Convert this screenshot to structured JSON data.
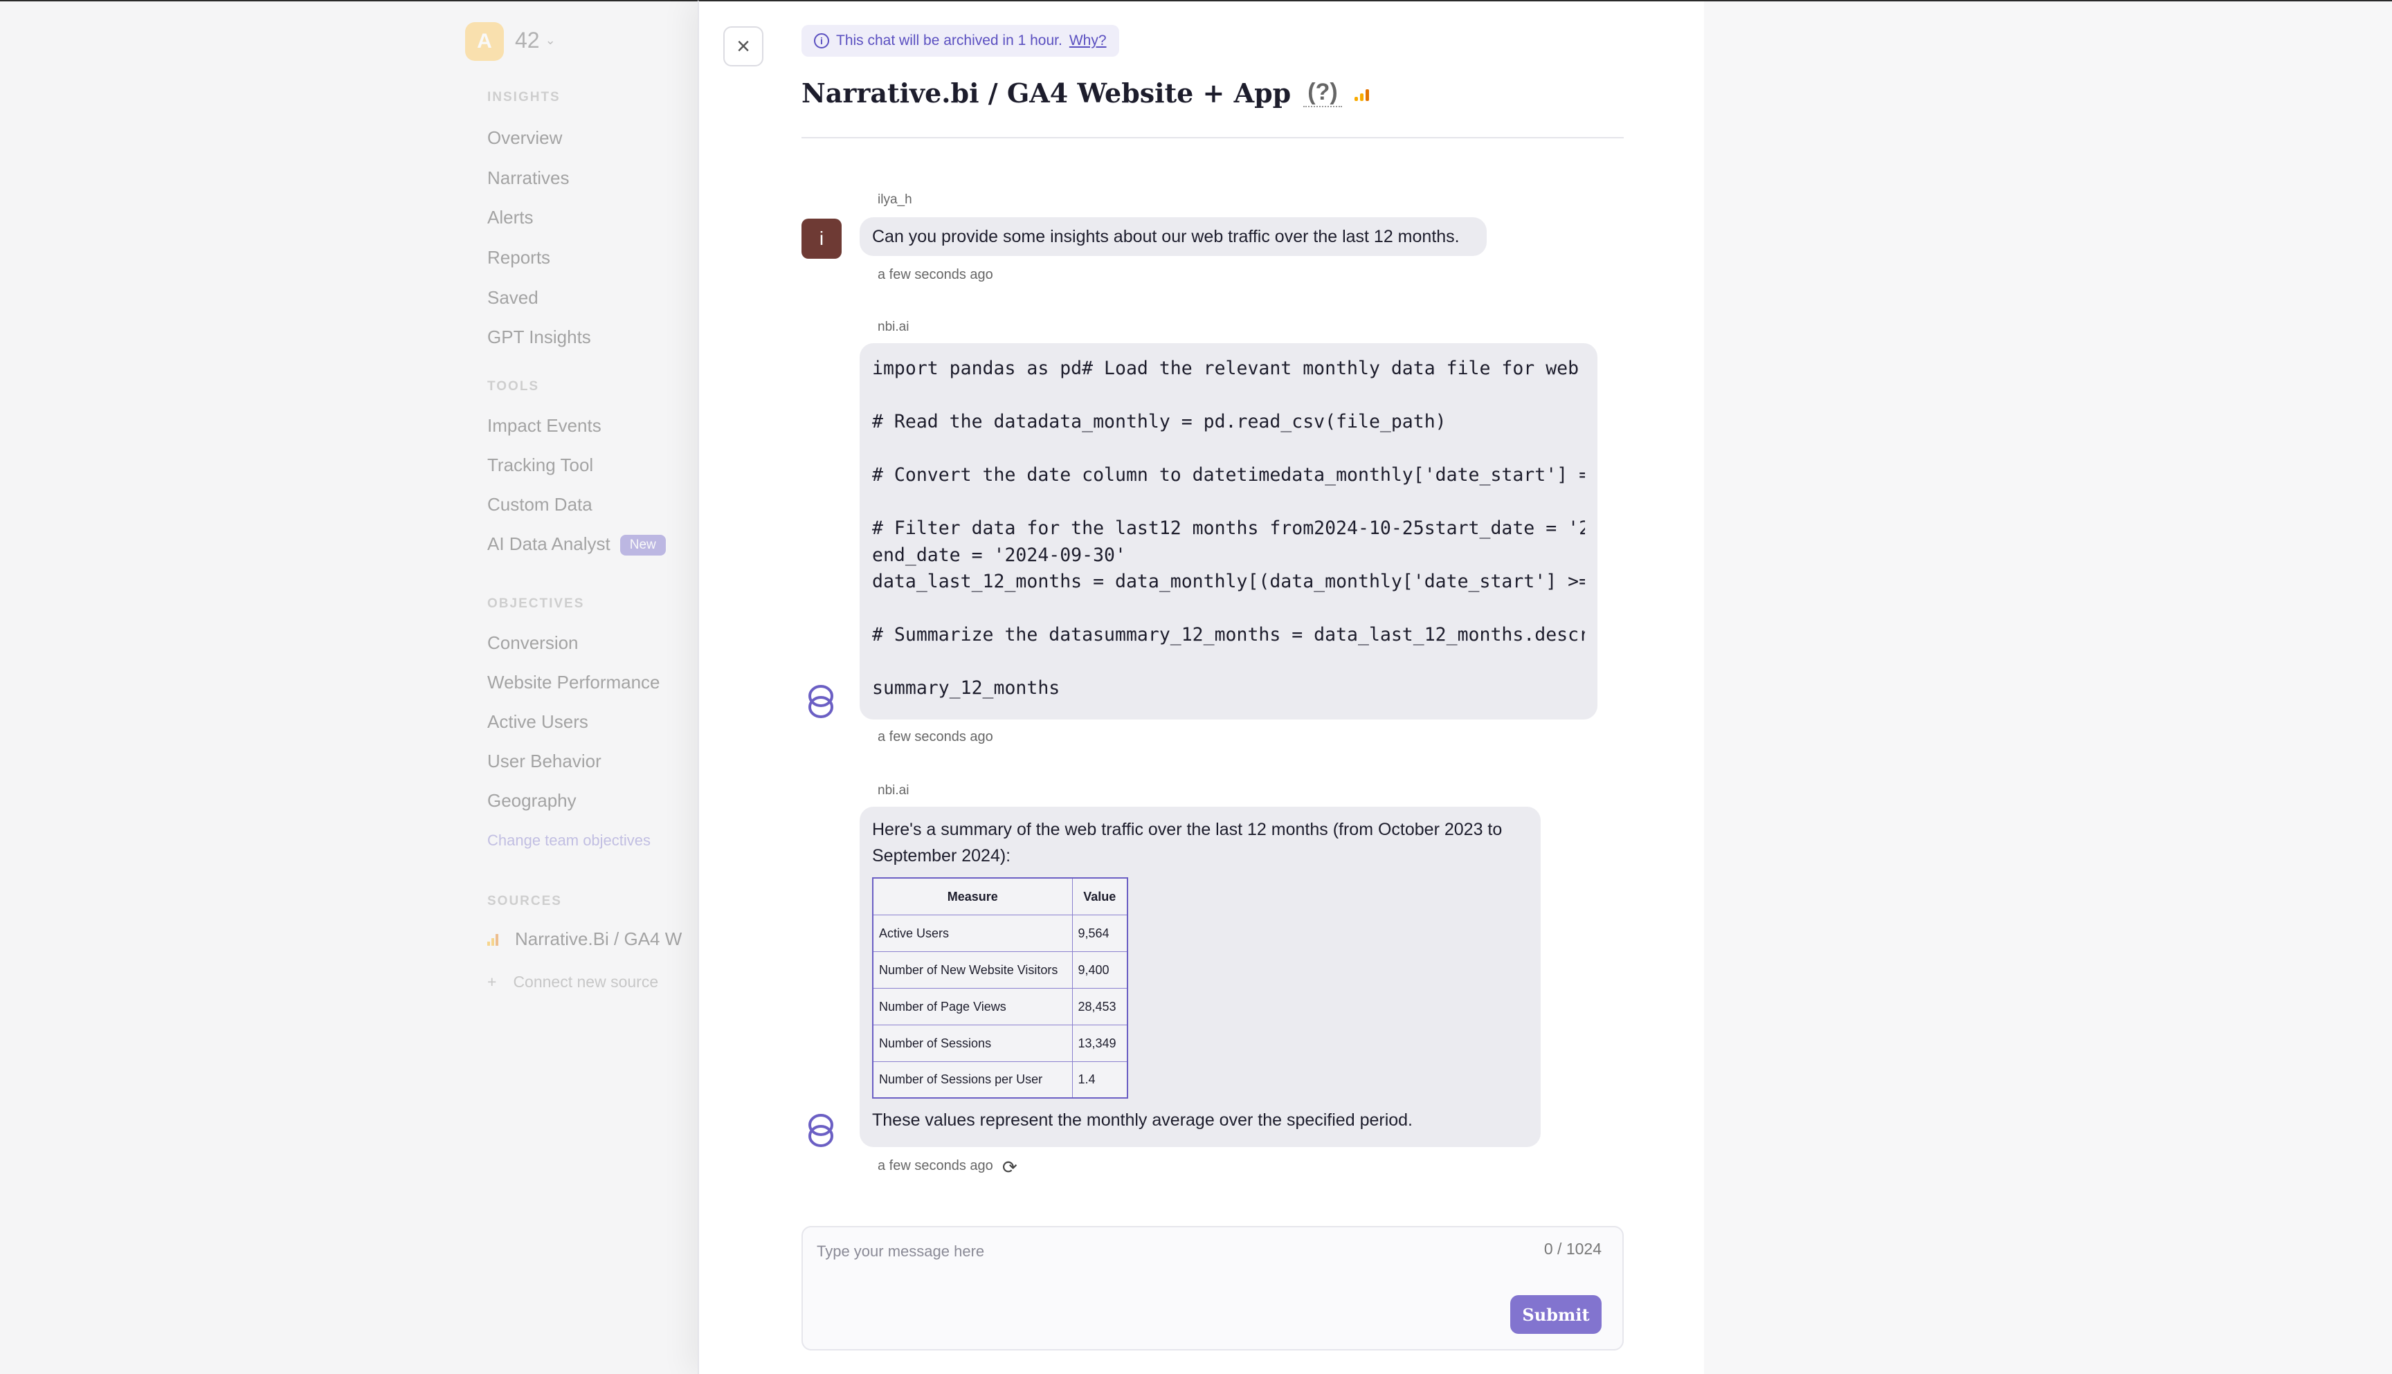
{
  "sidebar": {
    "logo_letter": "A",
    "team_count": "42",
    "sections": {
      "insights": "INSIGHTS",
      "tools": "TOOLS",
      "objectives": "OBJECTIVES",
      "sources": "SOURCES"
    },
    "insights_items": [
      "Overview",
      "Narratives",
      "Alerts",
      "Reports",
      "Saved",
      "GPT Insights"
    ],
    "tools_items": [
      "Impact Events",
      "Tracking Tool",
      "Custom Data",
      "AI Data Analyst"
    ],
    "new_badge": "New",
    "objectives_items": [
      "Conversion",
      "Website Performance",
      "Active Users",
      "User Behavior",
      "Geography"
    ],
    "change_objectives": "Change team objectives",
    "source_name": "Narrative.Bi / GA4 W",
    "connect_source": "Connect new source"
  },
  "panel": {
    "archive_notice": "This chat will be archived in 1 hour.",
    "archive_why": "Why?",
    "title": "Narrative.bi / GA4 Website + App",
    "help": "(?)"
  },
  "messages": [
    {
      "author": "ilya_h",
      "avatar_letter": "i",
      "text": "Can you provide some insights about our web traffic over the last 12 months.",
      "time": "a few seconds ago"
    },
    {
      "author": "nbi.ai",
      "code": "import pandas as pd# Load the relevant monthly data file for web tr\n\n# Read the datadata_monthly = pd.read_csv(file_path)\n\n# Convert the date column to datetimedata_monthly['date_start'] = p\n\n# Filter data for the last12 months from2024-10-25start_date = '202\nend_date = '2024-09-30'\ndata_last_12_months = data_monthly[(data_monthly['date_start'] >= s\n\n# Summarize the datasummary_12_months = data_last_12_months.describ\n\nsummary_12_months",
      "time": "a few seconds ago"
    },
    {
      "author": "nbi.ai",
      "intro": "Here's a summary of the web traffic over the last 12 months (from October 2023 to September 2024):",
      "table_headers": [
        "Measure",
        "Value"
      ],
      "table_rows": [
        [
          "Active Users",
          "9,564"
        ],
        [
          "Number of New Website Visitors",
          "9,400"
        ],
        [
          "Number of Page Views",
          "28,453"
        ],
        [
          "Number of Sessions",
          "13,349"
        ],
        [
          "Number of Sessions per User",
          "1.4"
        ]
      ],
      "outro": "These values represent the monthly average over the specified period.",
      "time": "a few seconds ago"
    }
  ],
  "composer": {
    "placeholder": "Type your message here",
    "counter": "0 / 1024",
    "submit_label": "Submit"
  }
}
